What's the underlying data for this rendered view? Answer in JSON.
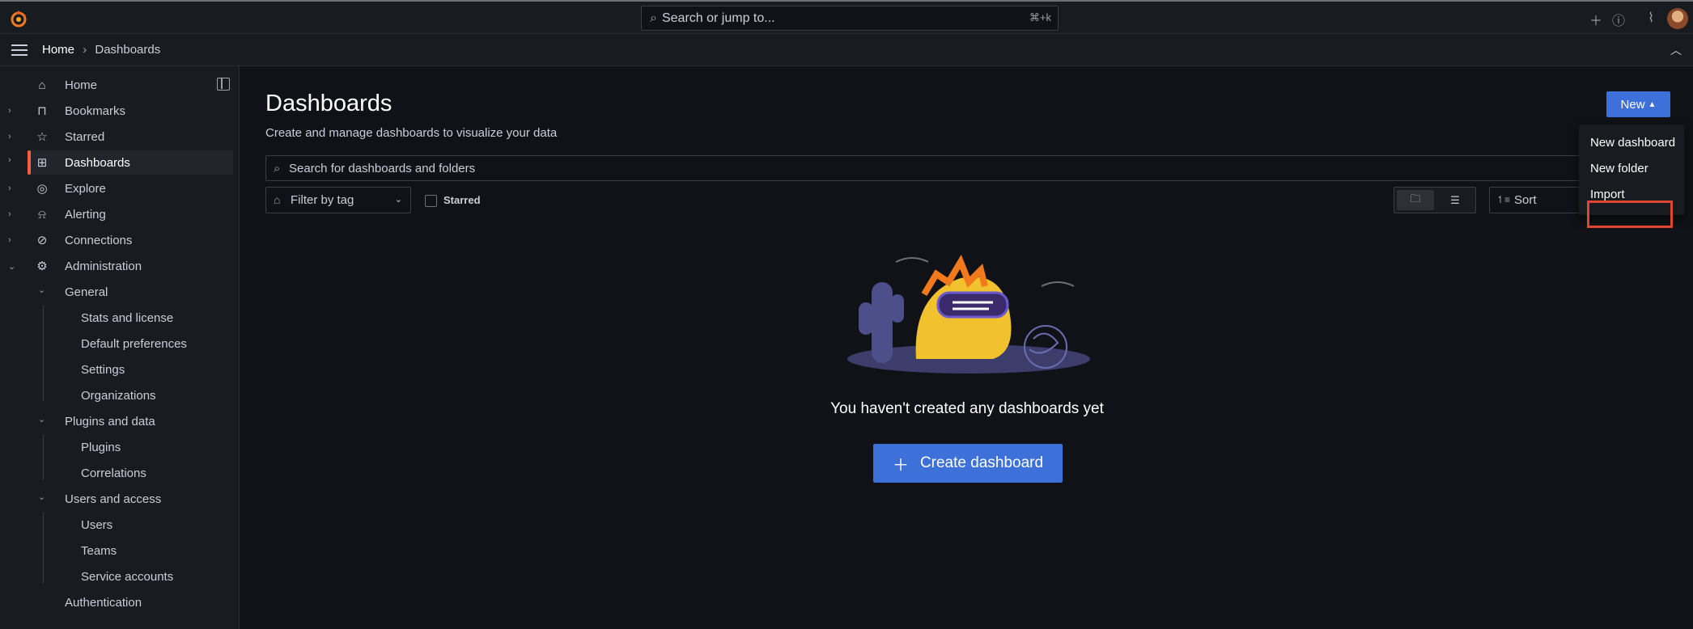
{
  "topbar": {
    "search_placeholder": "Search or jump to...",
    "search_shortcut": "⌘+k"
  },
  "breadcrumb": {
    "home": "Home",
    "separator": "›",
    "current": "Dashboards"
  },
  "sidebar": {
    "items": [
      {
        "label": "Home",
        "icon": "home-icon"
      },
      {
        "label": "Bookmarks",
        "icon": "bookmark-icon"
      },
      {
        "label": "Starred",
        "icon": "star-icon"
      },
      {
        "label": "Dashboards",
        "icon": "apps-icon",
        "active": true
      },
      {
        "label": "Explore",
        "icon": "compass-icon"
      },
      {
        "label": "Alerting",
        "icon": "bell-icon"
      },
      {
        "label": "Connections",
        "icon": "link-icon"
      },
      {
        "label": "Administration",
        "icon": "gear-icon"
      }
    ],
    "admin": {
      "general": "General",
      "general_items": [
        "Stats and license",
        "Default preferences",
        "Settings",
        "Organizations"
      ],
      "plugins": "Plugins and data",
      "plugins_items": [
        "Plugins",
        "Correlations"
      ],
      "users": "Users and access",
      "users_items": [
        "Users",
        "Teams",
        "Service accounts"
      ],
      "authentication": "Authentication"
    }
  },
  "main": {
    "title": "Dashboards",
    "subtitle": "Create and manage dashboards to visualize your data",
    "new_button": "New",
    "search_placeholder": "Search for dashboards and folders",
    "filter_placeholder": "Filter by tag",
    "starred_label": "Starred",
    "sort_label": "Sort",
    "empty_message": "You haven't created any dashboards yet",
    "create_button": "Create dashboard"
  },
  "new_menu": {
    "items": [
      "New dashboard",
      "New folder",
      "Import"
    ]
  },
  "colors": {
    "accent_blue": "#3d71d9",
    "active_orange": "#f55f3e",
    "highlight_red": "#e0452f"
  }
}
